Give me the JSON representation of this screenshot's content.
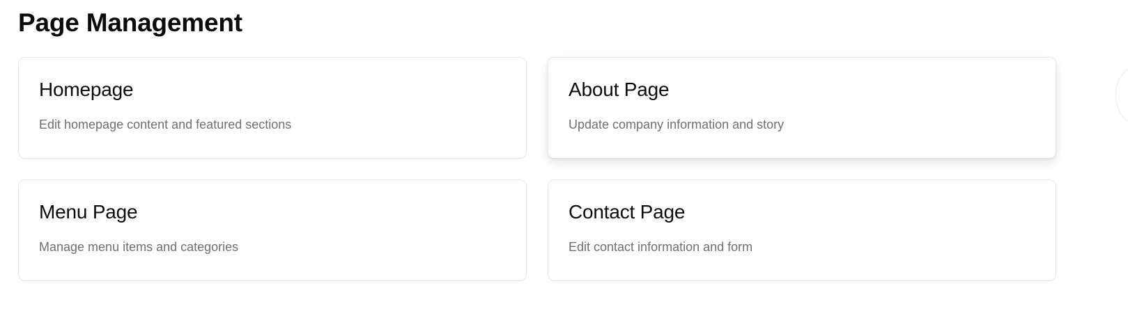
{
  "header": {
    "title": "Page Management"
  },
  "cards": [
    {
      "title": "Homepage",
      "description": "Edit homepage content and featured sections"
    },
    {
      "title": "About Page",
      "description": "Update company information and story"
    },
    {
      "title": "Menu Page",
      "description": "Manage menu items and categories"
    },
    {
      "title": "Contact Page",
      "description": "Edit contact information and form"
    }
  ],
  "state": {
    "hovered_card": "About Page"
  }
}
